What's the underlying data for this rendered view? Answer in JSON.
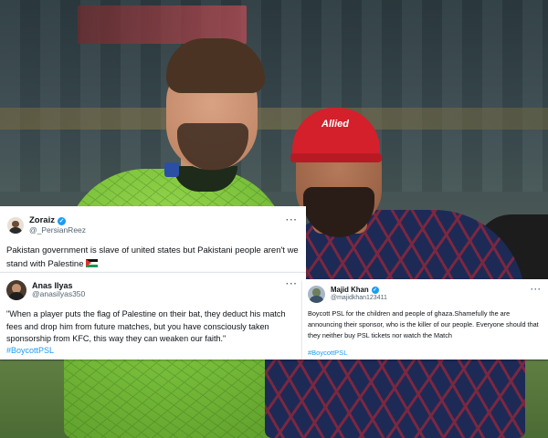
{
  "background": {
    "description_icon": "cricket-players-photo-icon",
    "cap_logo": "Allied"
  },
  "tweets": [
    {
      "display_name": "Zoraiz",
      "handle": "@_PersianReez",
      "verified": true,
      "text": "Pakistan government is slave of united states but Pakistani people aren't we stand with Palestine",
      "flag_icon": "palestine-flag-icon",
      "more_icon": "more-options-icon"
    },
    {
      "display_name": "Anas Ilyas",
      "handle": "@anasilyas350",
      "verified": false,
      "text": "\"When a player puts the flag of Palestine on their bat, they deduct his match fees and drop him from future matches, but you have consciously taken sponsorship from KFC, this way they can weaken our faith.\"",
      "hashtag": "#BoycottPSL",
      "more_icon": "more-options-icon"
    },
    {
      "display_name": "Majid Khan",
      "handle": "@majidkhan123411",
      "verified": true,
      "text": "Boycott PSL for the children and people of ghaza.Shamefully the are announcing their sponsor, who is the killer of our people. Everyone should that they neither buy PSL tickets nor watch the Match",
      "hashtag": "#BoycottPSL",
      "more_icon": "more-options-icon"
    }
  ],
  "colors": {
    "link": "#1d9bf0",
    "verified_badge": "#1d9bf0",
    "text": "#0f1419",
    "muted": "#536471"
  }
}
